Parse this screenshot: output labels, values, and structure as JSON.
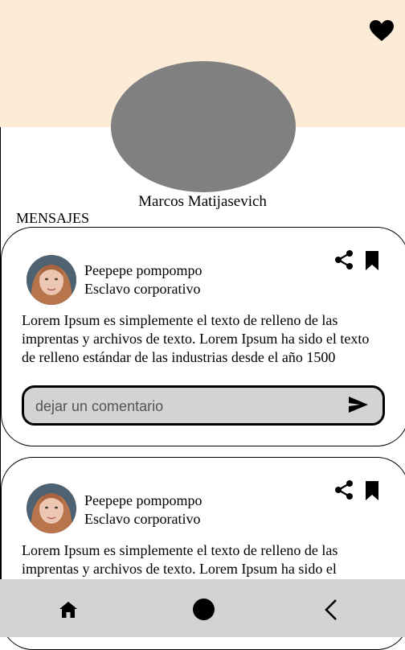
{
  "profile": {
    "name": "Marcos Matijasevich",
    "favorite_icon": "heart-icon",
    "cover_color": "#fbebd7",
    "avatar_color": "#808080"
  },
  "section": {
    "title": "MENSAJES"
  },
  "posts": [
    {
      "author": "Peepepe pompompo",
      "role": "Esclavo corporativo",
      "text": "Lorem Ipsum es simplemente el texto de relleno de las imprentas y archivos de texto. Lorem Ipsum ha sido el texto de relleno estándar de las industrias desde el año 1500",
      "share_icon": "share-icon",
      "bookmark_icon": "bookmark-icon",
      "comment": {
        "placeholder": "dejar un comentario",
        "value": "",
        "send_icon": "send-icon"
      }
    },
    {
      "author": "Peepepe pompompo",
      "role": "Esclavo corporativo",
      "text": "Lorem Ipsum es simplemente el texto de relleno de las imprentas y archivos de texto. Lorem Ipsum ha sido el",
      "share_icon": "share-icon",
      "bookmark_icon": "bookmark-icon"
    }
  ],
  "navbar": {
    "background": "#d3d3d3",
    "items": [
      "home-icon",
      "circle-icon",
      "back-chevron-icon"
    ]
  }
}
